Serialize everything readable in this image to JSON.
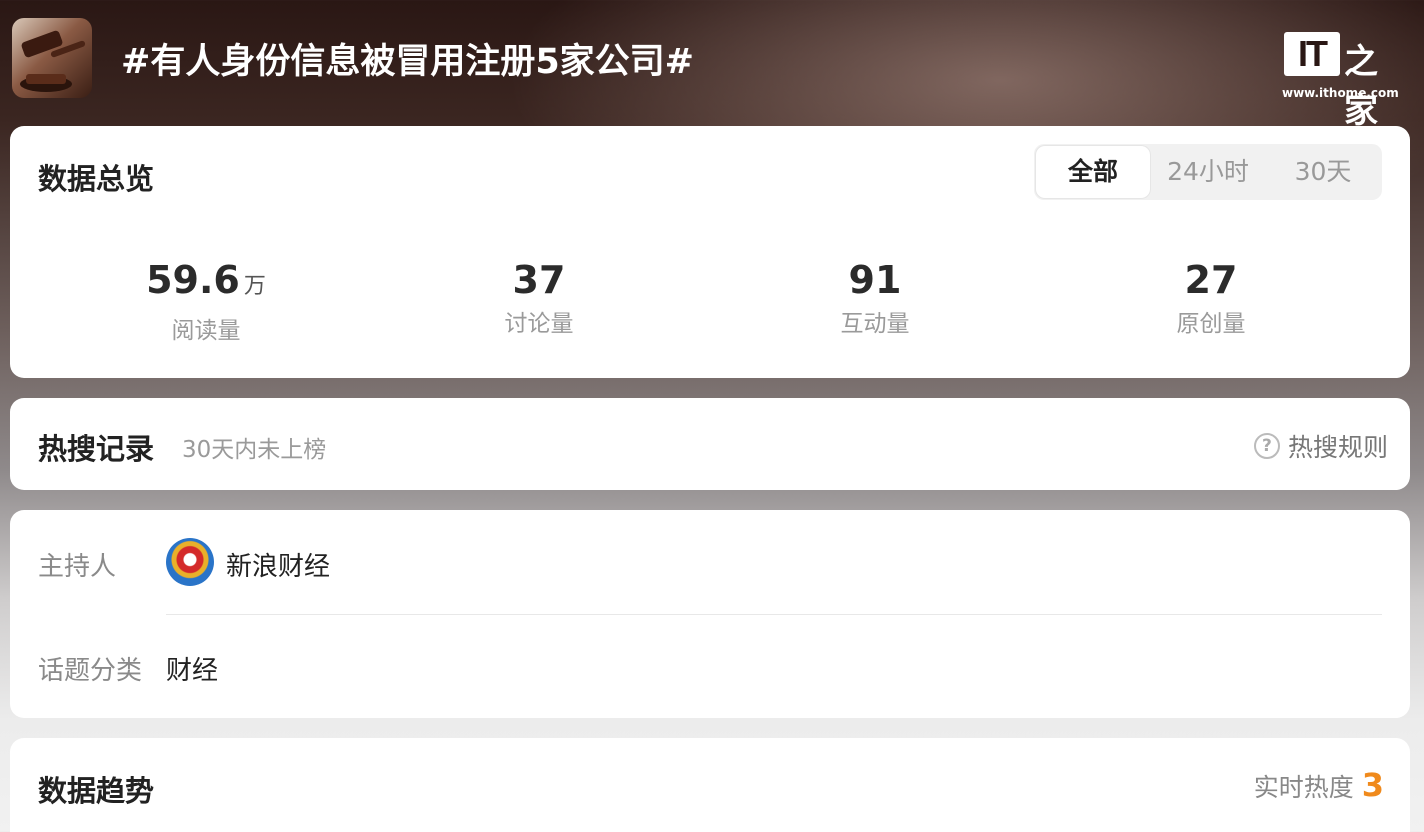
{
  "header": {
    "title": "#有人身份信息被冒用注册5家公司#",
    "brand_logo": "IT之家",
    "brand_url": "www.ithome.com"
  },
  "overview": {
    "title": "数据总览",
    "tabs": [
      "全部",
      "24小时",
      "30天"
    ],
    "active_tab": "全部",
    "stats": [
      {
        "value": "59.6",
        "unit": "万",
        "label": "阅读量"
      },
      {
        "value": "37",
        "unit": "",
        "label": "讨论量"
      },
      {
        "value": "91",
        "unit": "",
        "label": "互动量"
      },
      {
        "value": "27",
        "unit": "",
        "label": "原创量"
      }
    ]
  },
  "hot_search": {
    "title": "热搜记录",
    "subtitle": "30天内未上榜",
    "rules_label": "热搜规则",
    "rules_icon": "help-circle-icon"
  },
  "info": {
    "host_label": "主持人",
    "host_name": "新浪财经",
    "category_label": "话题分类",
    "category_value": "财经"
  },
  "trend": {
    "title": "数据趋势",
    "heat_label": "实时热度",
    "heat_value": "3"
  },
  "colors": {
    "accent_orange": "#f08a1c",
    "text_primary": "#222222",
    "text_secondary": "#9a9a9a"
  }
}
